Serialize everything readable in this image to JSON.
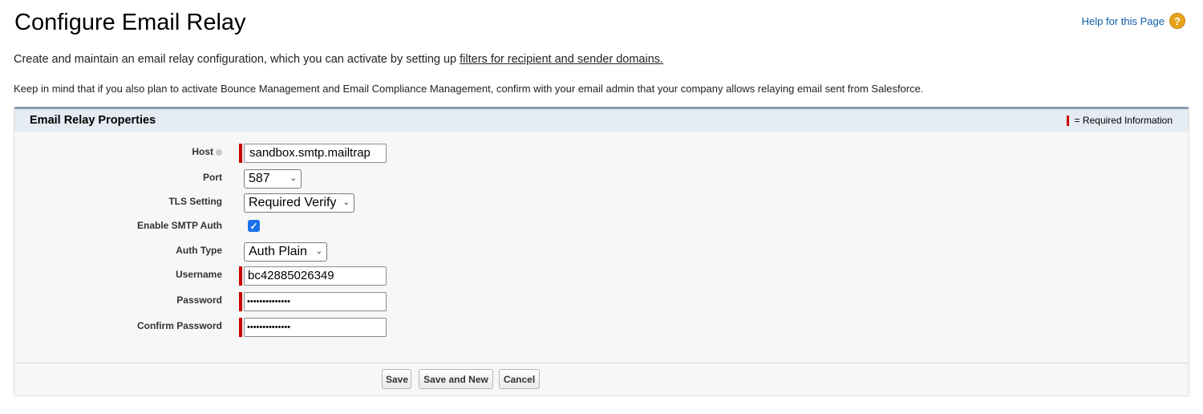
{
  "header": {
    "title": "Configure Email Relay",
    "help_link": "Help for this Page",
    "help_icon": "question-icon"
  },
  "intro": {
    "text": "Create and maintain an email relay configuration, which you can activate by setting up ",
    "link": "filters for recipient and sender domains."
  },
  "note": "Keep in mind that if you also plan to activate Bounce Management and Email Compliance Management, confirm with your email admin that your company allows relaying email sent from Salesforce.",
  "panel": {
    "title": "Email Relay Properties",
    "required_legend": "= Required Information"
  },
  "form": {
    "host": {
      "label": "Host",
      "value": "sandbox.smtp.mailtrap"
    },
    "port": {
      "label": "Port",
      "value": "587"
    },
    "tls": {
      "label": "TLS Setting",
      "value": "Required Verify"
    },
    "smtp_auth": {
      "label": "Enable SMTP Auth",
      "checked": true
    },
    "auth_type": {
      "label": "Auth Type",
      "value": "Auth Plain"
    },
    "username": {
      "label": "Username",
      "value": "bc42885026349"
    },
    "password": {
      "label": "Password",
      "value": "••••••••••••••"
    },
    "confirm_password": {
      "label": "Confirm Password",
      "value": "••••••••••••••"
    }
  },
  "buttons": {
    "save": "Save",
    "save_and_new": "Save and New",
    "cancel": "Cancel"
  },
  "colors": {
    "required": "#cc0000",
    "link": "#0e5ca8",
    "header_bar": "#e5ebf2",
    "checkbox": "#1a73e8"
  }
}
